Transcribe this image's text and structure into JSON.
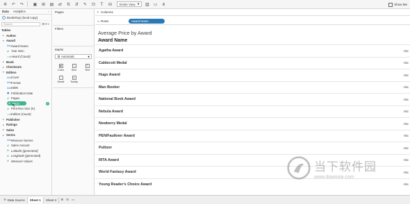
{
  "toolbar": {
    "fit_label": "Entire View",
    "show_me_label": "Show Me"
  },
  "data_pane": {
    "tabs": [
      "Data",
      "Analytics"
    ],
    "data_source": "Bookshop (local copy)",
    "search_placeholder": "Search",
    "items": [
      {
        "kind": "section",
        "label": "Tables"
      },
      {
        "kind": "table",
        "label": "Author"
      },
      {
        "kind": "table",
        "label": "Award",
        "open": true
      },
      {
        "kind": "field",
        "type": "dim",
        "glyph": "Abc",
        "label": "Award Name"
      },
      {
        "kind": "field",
        "type": "dim",
        "glyph": "#",
        "label": "Year Won"
      },
      {
        "kind": "field",
        "type": "meas",
        "glyph": "=#",
        "label": "Award (Count)",
        "italic": true
      },
      {
        "kind": "table",
        "label": "Book"
      },
      {
        "kind": "table",
        "label": "Checkouts"
      },
      {
        "kind": "table",
        "label": "Edition",
        "open": true
      },
      {
        "kind": "field",
        "type": "dim",
        "glyph": "Abc",
        "label": "Cover"
      },
      {
        "kind": "field",
        "type": "dim",
        "glyph": "Abc",
        "label": "Format"
      },
      {
        "kind": "field",
        "type": "dim",
        "glyph": "Abc",
        "label": "ISBN"
      },
      {
        "kind": "field",
        "type": "dim",
        "glyph": "▣",
        "label": "Publication Date"
      },
      {
        "kind": "field",
        "type": "meas",
        "glyph": "#",
        "label": "Pages"
      },
      {
        "kind": "field",
        "type": "meas",
        "glyph": "#",
        "label": "Price",
        "highlight": true
      },
      {
        "kind": "field",
        "type": "meas",
        "glyph": "#",
        "label": "Print Run Size (K)"
      },
      {
        "kind": "field",
        "type": "meas",
        "glyph": "=#",
        "label": "Edition (Count)",
        "italic": true
      },
      {
        "kind": "table",
        "label": "Publisher"
      },
      {
        "kind": "table",
        "label": "Ratings"
      },
      {
        "kind": "table",
        "label": "Sales"
      },
      {
        "kind": "table",
        "label": "Series"
      },
      {
        "kind": "field",
        "type": "dim",
        "glyph": "Abc",
        "label": "Measure Names",
        "italic": true
      },
      {
        "kind": "field",
        "type": "meas",
        "glyph": "#",
        "label": "Sales Amount"
      },
      {
        "kind": "field",
        "type": "meas",
        "glyph": "⊕",
        "label": "Latitude (generated)",
        "italic": true
      },
      {
        "kind": "field",
        "type": "meas",
        "glyph": "⊕",
        "label": "Longitude (generated)",
        "italic": true
      },
      {
        "kind": "field",
        "type": "meas",
        "glyph": "#",
        "label": "Measure Values",
        "italic": true
      }
    ]
  },
  "cards": {
    "pages": "Pages",
    "filters": "Filters",
    "marks": "Marks",
    "marks_type": "Automatic",
    "marks_buttons": [
      {
        "label": "Color",
        "glyph": "◉"
      },
      {
        "label": "Size",
        "glyph": "◌"
      },
      {
        "label": "Text",
        "glyph": "T"
      },
      {
        "label": "Detail",
        "glyph": "∴"
      },
      {
        "label": "Tooltip",
        "glyph": "▭"
      }
    ]
  },
  "shelves": {
    "columns_label": "Columns",
    "rows_label": "Rows",
    "rows_pill": "Award Name"
  },
  "view": {
    "title": "Average Price by Award",
    "column_header": "Award Name",
    "placeholder_text": "Abc",
    "rows": [
      "Agatha Award",
      "Caldecott Medal",
      "Hugo Award",
      "Man Booker",
      "National Book Award",
      "Nebula Award",
      "Newberry Medal",
      "PEN/Faulkner Award",
      "Pulitzer",
      "RITA Award",
      "World Fantasy Award",
      "Young Reader's Choice Award"
    ]
  },
  "status_bar": {
    "data_source_tab": "Data Source",
    "sheet_tabs": [
      "Sheet 1",
      "Sheet 2"
    ]
  },
  "watermark": {
    "cn_text": "当下软件园",
    "url": "www.downxia.com"
  }
}
